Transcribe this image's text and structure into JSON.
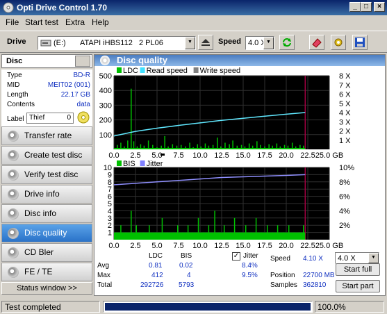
{
  "window": {
    "title": "Opti Drive Control 1.70"
  },
  "menu": [
    "File",
    "Start test",
    "Extra",
    "Help"
  ],
  "toolbar": {
    "drive_label": "Drive",
    "drive_letter": "(E:)",
    "drive_name": "ATAPI iHBS112   2 PL06",
    "speed_label": "Speed",
    "speed_value": "4.0 X"
  },
  "disc": {
    "header": "Disc",
    "props": [
      {
        "key": "Type",
        "value": "BD-R"
      },
      {
        "key": "MID",
        "value": "MEIT02 (001)"
      },
      {
        "key": "Length",
        "value": "22.17 GB"
      },
      {
        "key": "Contents",
        "value": "data"
      }
    ],
    "label_key": "Label",
    "label_value": "Thief",
    "label_count": "0"
  },
  "nav": [
    {
      "label": "Transfer rate",
      "active": false
    },
    {
      "label": "Create test disc",
      "active": false
    },
    {
      "label": "Verify test disc",
      "active": false
    },
    {
      "label": "Drive info",
      "active": false
    },
    {
      "label": "Disc info",
      "active": false
    },
    {
      "label": "Disc quality",
      "active": true
    },
    {
      "label": "CD Bler",
      "active": false
    },
    {
      "label": "FE / TE",
      "active": false
    }
  ],
  "status_window_btn": "Status window >>",
  "panel_title": "Disc quality",
  "chart_data": [
    {
      "type": "line",
      "legend": [
        "LDC",
        "Read speed",
        "Write speed"
      ],
      "colors": {
        "LDC": "#00c000",
        "Read speed": "#40e0ff",
        "Write speed": "#808080"
      },
      "x_ticks": [
        "0.0",
        "2.5",
        "5.0",
        "7.5",
        "10.0",
        "12.5",
        "15.0",
        "17.5",
        "20.0",
        "22.5",
        "25.0 GB"
      ],
      "xlim": [
        0,
        25
      ],
      "y_left_ticks": [
        "500",
        "400",
        "300",
        "200",
        "100"
      ],
      "ylim_left": [
        0,
        500
      ],
      "y_right_ticks": [
        "8 X",
        "7 X",
        "6 X",
        "5 X",
        "4 X",
        "3 X",
        "2 X",
        "1 X"
      ],
      "ylim_right": [
        0,
        8
      ],
      "ldc_spikes": [
        [
          0.4,
          30
        ],
        [
          0.8,
          45
        ],
        [
          1.2,
          20
        ],
        [
          1.6,
          60
        ],
        [
          2.0,
          412
        ],
        [
          2.3,
          55
        ],
        [
          2.7,
          20
        ],
        [
          3.1,
          35
        ],
        [
          3.5,
          25
        ],
        [
          4.0,
          60
        ],
        [
          4.5,
          30
        ],
        [
          5.0,
          15
        ],
        [
          5.5,
          25
        ],
        [
          5.9,
          90
        ],
        [
          6.3,
          20
        ],
        [
          6.8,
          35
        ],
        [
          7.3,
          25
        ],
        [
          7.8,
          30
        ],
        [
          8.3,
          20
        ],
        [
          8.8,
          45
        ],
        [
          9.2,
          15
        ],
        [
          9.7,
          35
        ],
        [
          10.1,
          20
        ],
        [
          10.6,
          40
        ],
        [
          11.0,
          25
        ],
        [
          11.5,
          30
        ],
        [
          12.0,
          80
        ],
        [
          12.4,
          20
        ],
        [
          12.9,
          45
        ],
        [
          13.4,
          35
        ],
        [
          13.8,
          60
        ],
        [
          14.3,
          25
        ],
        [
          14.8,
          30
        ],
        [
          15.2,
          20
        ],
        [
          15.7,
          40
        ],
        [
          16.1,
          25
        ],
        [
          16.6,
          55
        ],
        [
          17.0,
          30
        ],
        [
          17.5,
          20
        ],
        [
          18.0,
          35
        ],
        [
          18.4,
          25
        ],
        [
          18.9,
          40
        ],
        [
          19.3,
          20
        ],
        [
          19.8,
          30
        ],
        [
          20.2,
          25
        ],
        [
          20.7,
          45
        ],
        [
          21.1,
          20
        ],
        [
          21.6,
          30
        ],
        [
          22.0,
          25
        ]
      ],
      "read_speed_curve": [
        [
          0,
          1.45
        ],
        [
          2.5,
          1.95
        ],
        [
          5,
          2.3
        ],
        [
          7.5,
          2.6
        ],
        [
          10,
          2.88
        ],
        [
          12.5,
          3.15
        ],
        [
          15,
          3.38
        ],
        [
          17.5,
          3.6
        ],
        [
          20,
          3.82
        ],
        [
          22.2,
          4.0
        ]
      ]
    },
    {
      "type": "bar",
      "legend": [
        "BIS",
        "Jitter"
      ],
      "colors": {
        "BIS": "#00c000",
        "Jitter": "#8080ff"
      },
      "x_ticks": [
        "0.0",
        "2.5",
        "5.0",
        "7.5",
        "10.0",
        "12.5",
        "15.0",
        "17.5",
        "20.0",
        "22.5",
        "25.0 GB"
      ],
      "xlim": [
        0,
        25
      ],
      "y_left_ticks": [
        "10",
        "9",
        "8",
        "7",
        "6",
        "5",
        "4",
        "3",
        "2",
        "1"
      ],
      "ylim_left": [
        0,
        10
      ],
      "y_right_ticks": [
        "10%",
        "8%",
        "6%",
        "4%",
        "2%"
      ],
      "ylim_right": [
        0,
        10
      ],
      "bis_spikes": [
        [
          0.3,
          1
        ],
        [
          0.8,
          2
        ],
        [
          1.4,
          1
        ],
        [
          2.0,
          4
        ],
        [
          2.6,
          2
        ],
        [
          3.4,
          1
        ],
        [
          4.1,
          2
        ],
        [
          4.9,
          1
        ],
        [
          5.6,
          3
        ],
        [
          6.2,
          1
        ],
        [
          6.9,
          1
        ],
        [
          7.4,
          2
        ],
        [
          8.0,
          1
        ],
        [
          8.6,
          2
        ],
        [
          9.1,
          1
        ],
        [
          9.8,
          3
        ],
        [
          10.4,
          1
        ],
        [
          11.0,
          2
        ],
        [
          11.7,
          4
        ],
        [
          12.2,
          1
        ],
        [
          12.8,
          2
        ],
        [
          13.5,
          1
        ],
        [
          14.0,
          3
        ],
        [
          14.6,
          1
        ],
        [
          15.3,
          2
        ],
        [
          15.9,
          1
        ],
        [
          16.5,
          3
        ],
        [
          17.1,
          1
        ],
        [
          17.8,
          2
        ],
        [
          18.4,
          1
        ],
        [
          19.0,
          2
        ],
        [
          19.7,
          1
        ],
        [
          20.3,
          2
        ],
        [
          20.9,
          1
        ],
        [
          21.5,
          1
        ],
        [
          22.0,
          2
        ]
      ],
      "jitter_curve": [
        [
          0,
          7.6
        ],
        [
          2.5,
          7.8
        ],
        [
          5,
          8.0
        ],
        [
          7.5,
          8.2
        ],
        [
          10,
          8.4
        ],
        [
          12.5,
          8.6
        ],
        [
          15,
          8.7
        ],
        [
          17.5,
          8.8
        ],
        [
          20,
          8.9
        ],
        [
          22.2,
          9.0
        ]
      ]
    }
  ],
  "stats": {
    "col_ldc": "LDC",
    "col_bis": "BIS",
    "rows": [
      {
        "label": "Avg",
        "ldc": "0.81",
        "bis": "0.02",
        "jitter": "8.4%"
      },
      {
        "label": "Max",
        "ldc": "412",
        "bis": "4",
        "jitter": "9.5%"
      },
      {
        "label": "Total",
        "ldc": "292726",
        "bis": "5793"
      }
    ],
    "jitter_label": "Jitter",
    "speed_label": "Speed",
    "speed_value": "4.10 X",
    "speed_select": "4.0 X",
    "position_label": "Position",
    "position_value": "22700 MB",
    "samples_label": "Samples",
    "samples_value": "362810",
    "start_full": "Start full",
    "start_part": "Start part"
  },
  "statusbar": {
    "text": "Test completed",
    "progress": 1.0,
    "percent": "100.0%"
  }
}
